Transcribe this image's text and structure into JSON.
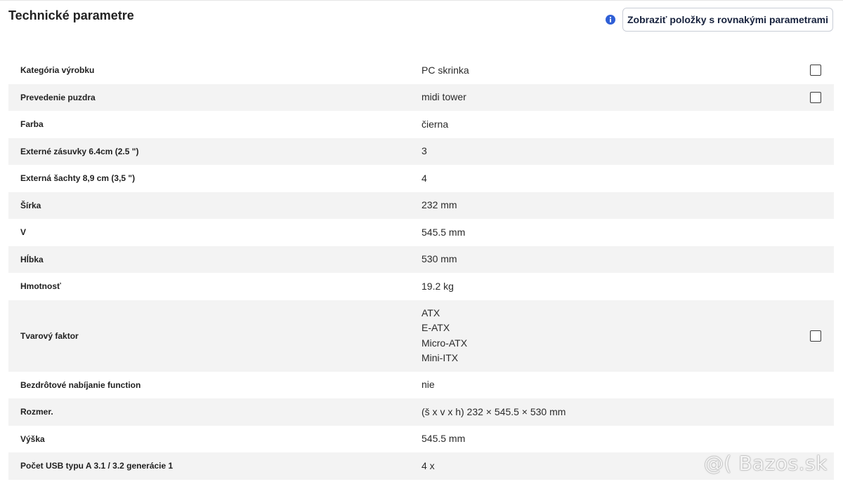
{
  "header": {
    "title": "Technické parametre",
    "compare_button": "Zobraziť položky s rovnakými parametrami",
    "info_icon": "info-icon",
    "accent_color": "#2f5fd6"
  },
  "params": [
    {
      "name": "Kategória výrobku",
      "values": [
        "PC skrinka"
      ],
      "checkbox": true
    },
    {
      "name": "Prevedenie puzdra",
      "values": [
        "midi tower"
      ],
      "checkbox": true
    },
    {
      "name": "Farba",
      "values": [
        "čierna"
      ],
      "checkbox": false
    },
    {
      "name": "Externé zásuvky 6.4cm (2.5 \")",
      "values": [
        "3"
      ],
      "checkbox": false
    },
    {
      "name": "Externá šachty 8,9 cm (3,5 \")",
      "values": [
        "4"
      ],
      "checkbox": false
    },
    {
      "name": "Šírka",
      "values": [
        "232 mm"
      ],
      "checkbox": false
    },
    {
      "name": "V",
      "values": [
        "545.5 mm"
      ],
      "checkbox": false
    },
    {
      "name": "Hĺbka",
      "values": [
        "530 mm"
      ],
      "checkbox": false
    },
    {
      "name": "Hmotnosť",
      "values": [
        "19.2 kg"
      ],
      "checkbox": false
    },
    {
      "name": "Tvarový faktor",
      "values": [
        "ATX",
        "E-ATX",
        "Micro-ATX",
        "Mini-ITX"
      ],
      "checkbox": true
    },
    {
      "name": "Bezdrôtové nabíjanie function",
      "values": [
        "nie"
      ],
      "checkbox": false
    },
    {
      "name": "Rozmer.",
      "values": [
        "(š x v x h) 232 × 545.5 × 530 mm"
      ],
      "checkbox": false
    },
    {
      "name": "Výška",
      "values": [
        "545.5 mm"
      ],
      "checkbox": false
    },
    {
      "name": "Počet USB typu A 3.1 / 3.2 generácie 1",
      "values": [
        "4 x"
      ],
      "checkbox": false
    }
  ],
  "watermark": "@( Bazos.sk"
}
